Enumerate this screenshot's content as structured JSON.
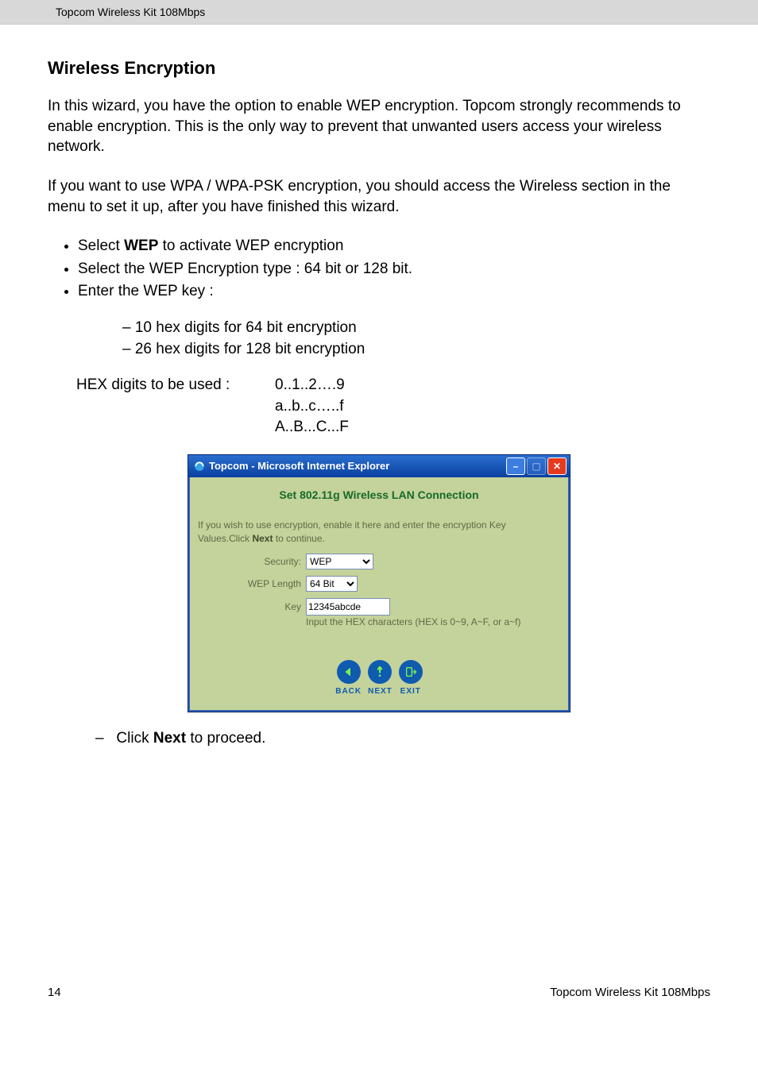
{
  "header": "Topcom Wireless Kit 108Mbps",
  "title": "Wireless Encryption",
  "para1": "In this wizard, you have the option to enable WEP encryption. Topcom strongly recommends to enable encryption. This is the only way to prevent that unwanted users access your wireless network.",
  "para2": "If you want to use WPA / WPA-PSK encryption, you should access the Wireless section in the menu to set it up, after you have finished this wizard.",
  "bullets": {
    "b1_pre": "Select ",
    "b1_bold": "WEP",
    "b1_post": " to activate WEP encryption",
    "b2": "Select the WEP Encryption type : 64 bit or 128 bit.",
    "b3": "Enter the WEP key :",
    "d1": "10 hex digits for 64 bit encryption",
    "d2": "26 hex digits for 128 bit encryption"
  },
  "hex": {
    "label": "HEX  digits to be used :",
    "l1": "0..1..2….9",
    "l2": "a..b..c…..f",
    "l3": "A..B...C...F"
  },
  "win": {
    "title": "Topcom - Microsoft Internet Explorer",
    "heading": "Set 802.11g Wireless LAN Connection",
    "intro_a": "If you wish to use encryption, enable it here and enter the encryption Key Values.Click ",
    "intro_bold": "Next",
    "intro_b": " to continue.",
    "security_label": "Security:",
    "security_value": "WEP",
    "weplen_label": "WEP Length",
    "weplen_value": "64 Bit",
    "key_label": "Key",
    "key_value": "12345abcde",
    "hint": "Input the HEX characters (HEX is 0~9, A~F, or a~f)",
    "back": "BACK",
    "next": "NEXT",
    "exit": "EXIT"
  },
  "final_pre": "Click ",
  "final_bold": "Next",
  "final_post": " to proceed.",
  "footer": {
    "page": "14",
    "product": "Topcom Wireless Kit 108Mbps"
  }
}
